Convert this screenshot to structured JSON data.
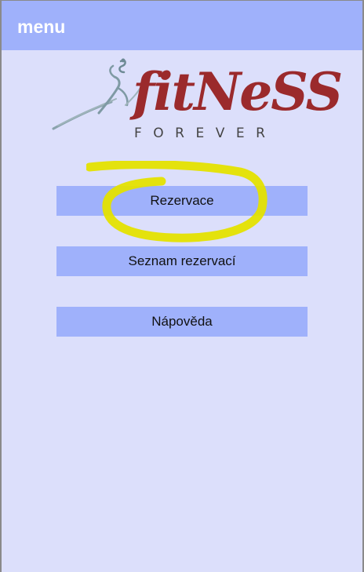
{
  "appbar": {
    "title": "menu"
  },
  "logo": {
    "word": "fitNeSS",
    "sub": "FOREVER"
  },
  "menu": {
    "items": [
      {
        "label": "Rezervace"
      },
      {
        "label": "Seznam rezervací"
      },
      {
        "label": "Nápověda"
      }
    ]
  },
  "colors": {
    "background": "#dcdffb",
    "appbar": "#9fb1fb",
    "button": "#9fb1fb",
    "brand_red": "#9b2a2c",
    "highlight": "#e4e100"
  },
  "annotation": {
    "type": "yellow-circle-highlight",
    "target": "Rezervace"
  }
}
